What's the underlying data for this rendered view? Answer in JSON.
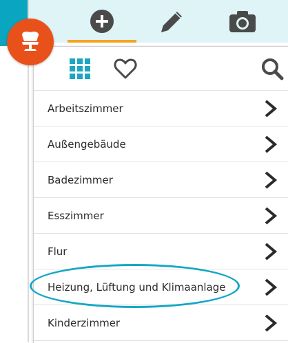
{
  "colors": {
    "accent_teal": "#0aa5c0",
    "top_bar_bg": "#def4f6",
    "tab_active_underline": "#f5a623",
    "brand_orange": "#e8521a",
    "grid_icon": "#1ba6c4",
    "text": "#2b2b2b",
    "highlight_ring": "#14a8c4"
  },
  "top_tabs": [
    {
      "icon": "plus-circle-icon",
      "active": true
    },
    {
      "icon": "pencil-icon",
      "active": false
    },
    {
      "icon": "camera-icon",
      "active": false
    }
  ],
  "brand_badge": {
    "icon": "chair-icon"
  },
  "toolbar": {
    "grid_icon": "grid-icon",
    "favorites_icon": "heart-icon",
    "search_icon": "search-icon"
  },
  "rooms": [
    {
      "label": "Arbeitszimmer"
    },
    {
      "label": "Außengebäude"
    },
    {
      "label": "Badezimmer"
    },
    {
      "label": "Esszimmer"
    },
    {
      "label": "Flur"
    },
    {
      "label": "Heizung, Lüftung und Klimaanlage",
      "highlighted": true
    },
    {
      "label": "Kinderzimmer"
    }
  ]
}
